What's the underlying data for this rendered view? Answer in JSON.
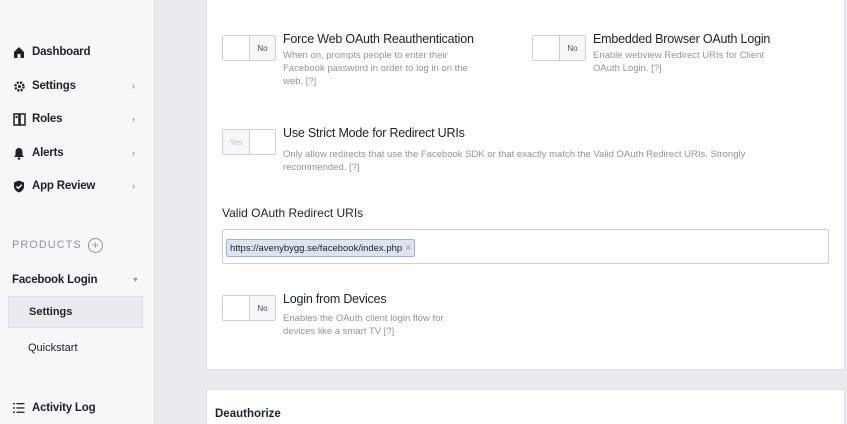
{
  "sidebar": {
    "items": [
      {
        "label": "Dashboard",
        "icon": "dashboard-icon",
        "chevron": false
      },
      {
        "label": "Settings",
        "icon": "gear-icon",
        "chevron": true
      },
      {
        "label": "Roles",
        "icon": "roles-icon",
        "chevron": true
      },
      {
        "label": "Alerts",
        "icon": "bell-icon",
        "chevron": true
      },
      {
        "label": "App Review",
        "icon": "shield-check-icon",
        "chevron": true
      }
    ],
    "products_label": "PRODUCTS",
    "product": {
      "label": "Facebook Login",
      "caret": "▼"
    },
    "sub_items": [
      {
        "label": "Settings",
        "active": true
      },
      {
        "label": "Quickstart",
        "active": false
      }
    ],
    "activity_log": "Activity Log",
    "chevron_glyph": "›"
  },
  "settings": {
    "force_reauth": {
      "title": "Force Web OAuth Reauthentication",
      "desc_lines": [
        "When on, prompts people to enter their",
        "Facebook password in order to log in on the",
        "web. [?]"
      ],
      "toggle": "No"
    },
    "embedded_browser": {
      "title": "Embedded Browser OAuth Login",
      "desc_lines": [
        "Enable webview Redirect URIs for Client",
        "OAuth Login. [?]"
      ],
      "toggle": "No"
    },
    "strict_mode": {
      "title": "Use Strict Mode for Redirect URIs",
      "desc_lines": [
        "Only allow redirects that use the Facebook SDK or that exactly match the Valid OAuth Redirect URIs. Strongly",
        "recommended. [?]"
      ],
      "toggle": "Yes"
    },
    "redirect_uris": {
      "label": "Valid OAuth Redirect URIs",
      "token": "https://avenybygg.se/facebook/index.php",
      "remove": "×"
    },
    "login_devices": {
      "title": "Login from Devices",
      "desc_lines": [
        "Enables the OAuth client login flow for",
        "devices like a smart TV [?]"
      ],
      "toggle": "No"
    }
  },
  "deauthorize": {
    "title": "Deauthorize"
  },
  "colors": {
    "accent": "#4267b2",
    "page_bg": "#e9ebee",
    "muted": "#90949c"
  }
}
